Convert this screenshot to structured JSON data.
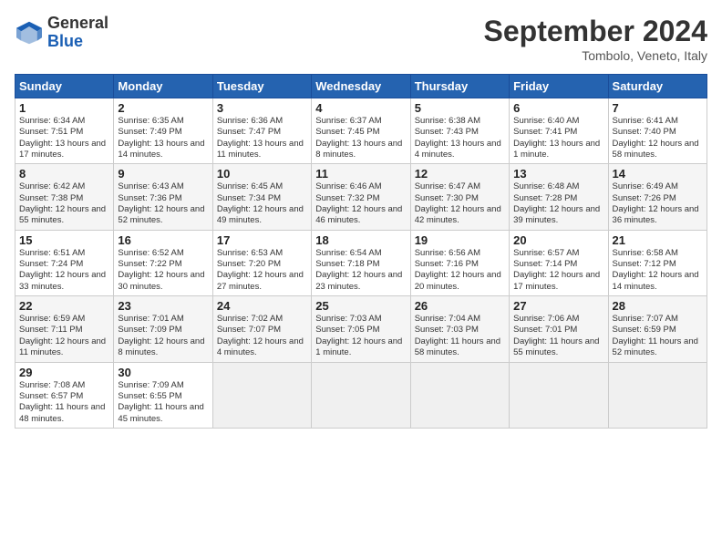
{
  "header": {
    "logo": {
      "general": "General",
      "blue": "Blue"
    },
    "title": "September 2024",
    "location": "Tombolo, Veneto, Italy"
  },
  "calendar": {
    "headers": [
      "Sunday",
      "Monday",
      "Tuesday",
      "Wednesday",
      "Thursday",
      "Friday",
      "Saturday"
    ],
    "weeks": [
      [
        {
          "day": "1",
          "sunrise": "6:34 AM",
          "sunset": "7:51 PM",
          "daylight": "13 hours and 17 minutes."
        },
        {
          "day": "2",
          "sunrise": "6:35 AM",
          "sunset": "7:49 PM",
          "daylight": "13 hours and 14 minutes."
        },
        {
          "day": "3",
          "sunrise": "6:36 AM",
          "sunset": "7:47 PM",
          "daylight": "13 hours and 11 minutes."
        },
        {
          "day": "4",
          "sunrise": "6:37 AM",
          "sunset": "7:45 PM",
          "daylight": "13 hours and 8 minutes."
        },
        {
          "day": "5",
          "sunrise": "6:38 AM",
          "sunset": "7:43 PM",
          "daylight": "13 hours and 4 minutes."
        },
        {
          "day": "6",
          "sunrise": "6:40 AM",
          "sunset": "7:41 PM",
          "daylight": "13 hours and 1 minute."
        },
        {
          "day": "7",
          "sunrise": "6:41 AM",
          "sunset": "7:40 PM",
          "daylight": "12 hours and 58 minutes."
        }
      ],
      [
        {
          "day": "8",
          "sunrise": "6:42 AM",
          "sunset": "7:38 PM",
          "daylight": "12 hours and 55 minutes."
        },
        {
          "day": "9",
          "sunrise": "6:43 AM",
          "sunset": "7:36 PM",
          "daylight": "12 hours and 52 minutes."
        },
        {
          "day": "10",
          "sunrise": "6:45 AM",
          "sunset": "7:34 PM",
          "daylight": "12 hours and 49 minutes."
        },
        {
          "day": "11",
          "sunrise": "6:46 AM",
          "sunset": "7:32 PM",
          "daylight": "12 hours and 46 minutes."
        },
        {
          "day": "12",
          "sunrise": "6:47 AM",
          "sunset": "7:30 PM",
          "daylight": "12 hours and 42 minutes."
        },
        {
          "day": "13",
          "sunrise": "6:48 AM",
          "sunset": "7:28 PM",
          "daylight": "12 hours and 39 minutes."
        },
        {
          "day": "14",
          "sunrise": "6:49 AM",
          "sunset": "7:26 PM",
          "daylight": "12 hours and 36 minutes."
        }
      ],
      [
        {
          "day": "15",
          "sunrise": "6:51 AM",
          "sunset": "7:24 PM",
          "daylight": "12 hours and 33 minutes."
        },
        {
          "day": "16",
          "sunrise": "6:52 AM",
          "sunset": "7:22 PM",
          "daylight": "12 hours and 30 minutes."
        },
        {
          "day": "17",
          "sunrise": "6:53 AM",
          "sunset": "7:20 PM",
          "daylight": "12 hours and 27 minutes."
        },
        {
          "day": "18",
          "sunrise": "6:54 AM",
          "sunset": "7:18 PM",
          "daylight": "12 hours and 23 minutes."
        },
        {
          "day": "19",
          "sunrise": "6:56 AM",
          "sunset": "7:16 PM",
          "daylight": "12 hours and 20 minutes."
        },
        {
          "day": "20",
          "sunrise": "6:57 AM",
          "sunset": "7:14 PM",
          "daylight": "12 hours and 17 minutes."
        },
        {
          "day": "21",
          "sunrise": "6:58 AM",
          "sunset": "7:12 PM",
          "daylight": "12 hours and 14 minutes."
        }
      ],
      [
        {
          "day": "22",
          "sunrise": "6:59 AM",
          "sunset": "7:11 PM",
          "daylight": "12 hours and 11 minutes."
        },
        {
          "day": "23",
          "sunrise": "7:01 AM",
          "sunset": "7:09 PM",
          "daylight": "12 hours and 8 minutes."
        },
        {
          "day": "24",
          "sunrise": "7:02 AM",
          "sunset": "7:07 PM",
          "daylight": "12 hours and 4 minutes."
        },
        {
          "day": "25",
          "sunrise": "7:03 AM",
          "sunset": "7:05 PM",
          "daylight": "12 hours and 1 minute."
        },
        {
          "day": "26",
          "sunrise": "7:04 AM",
          "sunset": "7:03 PM",
          "daylight": "11 hours and 58 minutes."
        },
        {
          "day": "27",
          "sunrise": "7:06 AM",
          "sunset": "7:01 PM",
          "daylight": "11 hours and 55 minutes."
        },
        {
          "day": "28",
          "sunrise": "7:07 AM",
          "sunset": "6:59 PM",
          "daylight": "11 hours and 52 minutes."
        }
      ],
      [
        {
          "day": "29",
          "sunrise": "7:08 AM",
          "sunset": "6:57 PM",
          "daylight": "11 hours and 48 minutes."
        },
        {
          "day": "30",
          "sunrise": "7:09 AM",
          "sunset": "6:55 PM",
          "daylight": "11 hours and 45 minutes."
        },
        null,
        null,
        null,
        null,
        null
      ]
    ]
  }
}
